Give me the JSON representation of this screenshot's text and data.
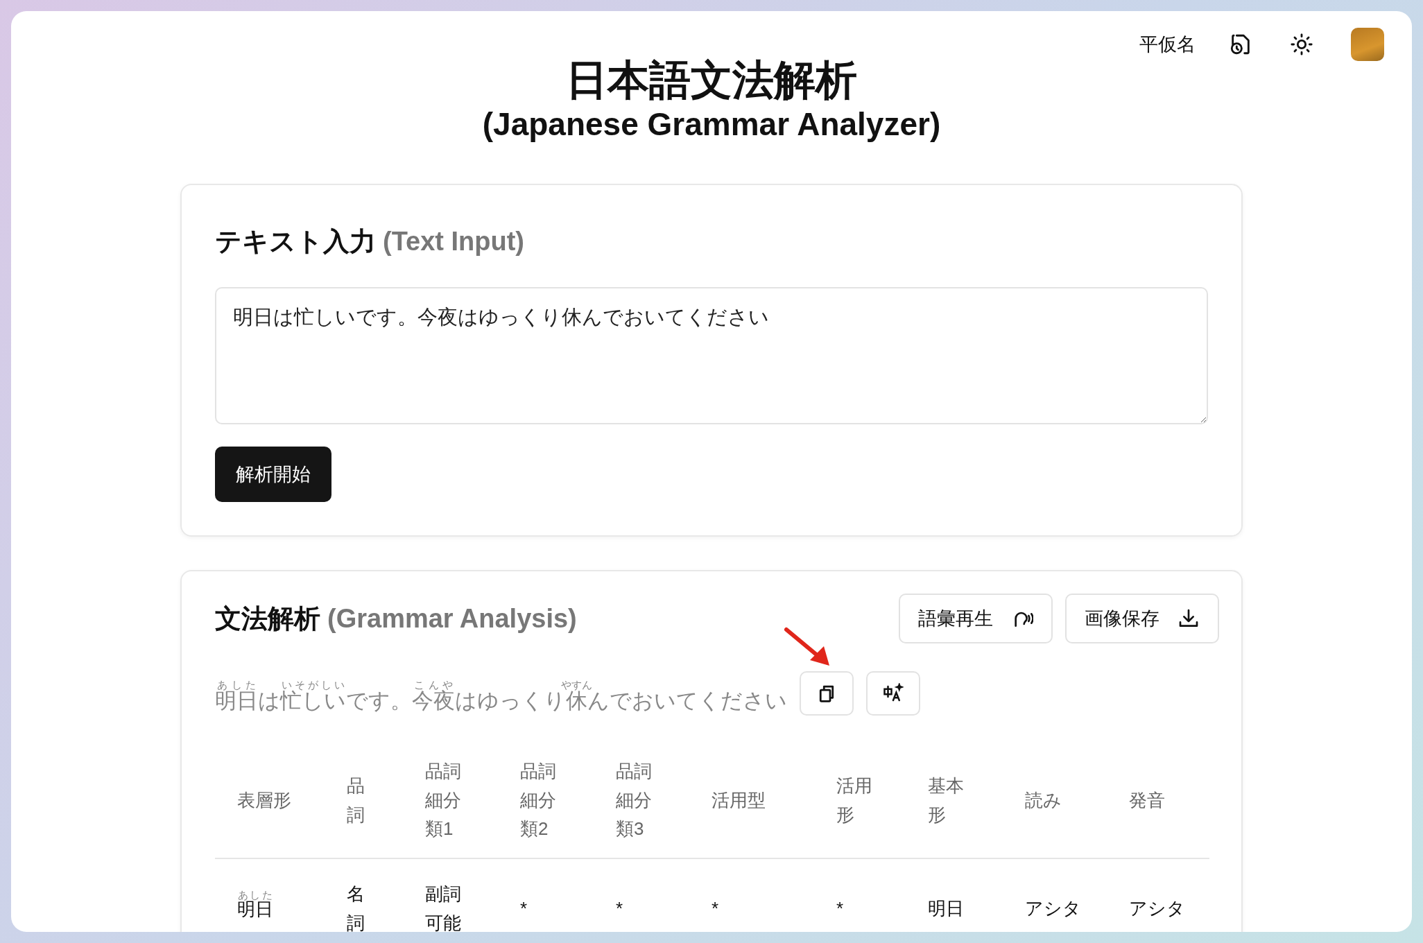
{
  "header": {
    "kana_toggle": "平仮名"
  },
  "title": {
    "japanese": "日本語文法解析",
    "english": "(Japanese Grammar Analyzer)"
  },
  "input_card": {
    "title_ja": "テキスト入力",
    "title_en": "(Text Input)",
    "value": "明日は忙しいです。今夜はゆっくり休んでおいてください",
    "button": "解析開始"
  },
  "analysis_card": {
    "title_ja": "文法解析",
    "title_en": "(Grammar Analysis)",
    "buttons": [
      {
        "label": "語彙再生",
        "kind": "speak"
      },
      {
        "label": "画像保存",
        "kind": "download"
      }
    ],
    "sentence": [
      {
        "text": "明日",
        "reading": "あした"
      },
      {
        "text": "は"
      },
      {
        "text": "忙しい",
        "reading": "いそがしい"
      },
      {
        "text": "です。"
      },
      {
        "text": "今夜",
        "reading": "こんや"
      },
      {
        "text": "はゆっくり"
      },
      {
        "text": "休",
        "reading": "やすん"
      },
      {
        "text": "んでおいてください"
      }
    ],
    "columns": [
      "表層形",
      "品詞",
      "品詞細分類1",
      "品詞細分類2",
      "品詞細分類3",
      "活用型",
      "活用形",
      "基本形",
      "読み",
      "発音"
    ],
    "rows": [
      {
        "cells": [
          {
            "text": "明日",
            "reading": "あした"
          },
          {
            "text": "名詞"
          },
          {
            "text": "副詞可能"
          },
          {
            "text": "*"
          },
          {
            "text": "*"
          },
          {
            "text": "*"
          },
          {
            "text": "*"
          },
          {
            "text": "明日"
          },
          {
            "text": "アシタ"
          },
          {
            "text": "アシタ"
          }
        ]
      }
    ]
  }
}
